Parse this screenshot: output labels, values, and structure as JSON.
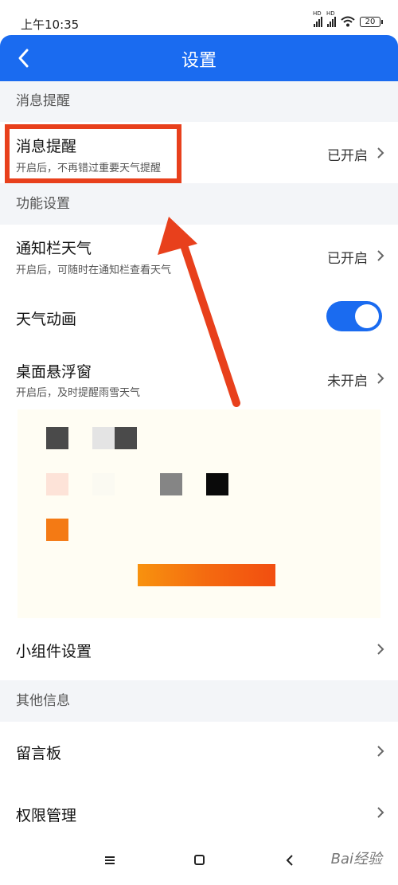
{
  "status": {
    "time": "上午10:35",
    "hd1": "HD",
    "hd2": "HD",
    "battery": "20"
  },
  "header": {
    "title": "设置"
  },
  "sections": {
    "messages": {
      "title": "消息提醒"
    },
    "functions": {
      "title": "功能设置"
    },
    "other": {
      "title": "其他信息"
    }
  },
  "rows": {
    "message_reminder": {
      "title": "消息提醒",
      "subtitle": "开启后，不再错过重要天气提醒",
      "value": "已开启"
    },
    "notification_weather": {
      "title": "通知栏天气",
      "subtitle": "开启后，可随时在通知栏查看天气",
      "value": "已开启"
    },
    "weather_animation": {
      "title": "天气动画",
      "enabled": true
    },
    "desktop_float": {
      "title": "桌面悬浮窗",
      "subtitle": "开启后，及时提醒雨雪天气",
      "value": "未开启"
    },
    "widget_settings": {
      "title": "小组件设置"
    },
    "message_board": {
      "title": "留言板"
    },
    "permissions": {
      "title": "权限管理"
    }
  },
  "watermark": "Bai经验",
  "colors": {
    "accent": "#1a6bf0",
    "highlight": "#e8401c",
    "section_bg": "#f3f5f8"
  }
}
